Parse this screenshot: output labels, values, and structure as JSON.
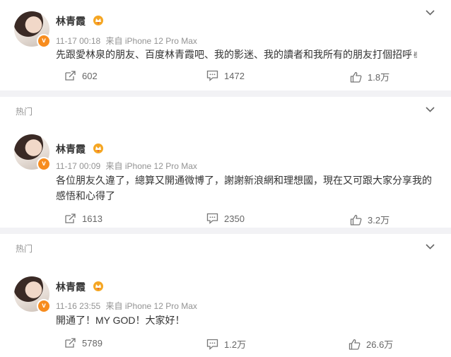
{
  "posts": [
    {
      "hot_label": "",
      "name": "林青霞",
      "time": "11-17 00:18",
      "source": "来自 iPhone 12 Pro Max",
      "text": "先跟愛林泉的朋友、百度林青霞吧、我的影迷、我的讀者和我所有的朋友打個招呼",
      "emoji": "✌",
      "repost": "602",
      "comment": "1472",
      "like": "1.8万"
    },
    {
      "hot_label": "热门",
      "name": "林青霞",
      "time": "11-17 00:09",
      "source": "来自 iPhone 12 Pro Max",
      "text": "各位朋友久違了，總算又開通微博了，謝謝新浪網和理想國，現在又可跟大家分享我的感悟和心得了",
      "emoji": "",
      "repost": "1613",
      "comment": "2350",
      "like": "3.2万"
    },
    {
      "hot_label": "热门",
      "name": "林青霞",
      "time": "11-16 23:55",
      "source": "来自 iPhone 12 Pro Max",
      "text": "開通了！MY GOD！大家好！",
      "emoji": "",
      "repost": "5789",
      "comment": "1.2万",
      "like": "26.6万"
    }
  ],
  "colors": {
    "meta": "#939393",
    "badge": "#f78c1e",
    "crown": "#f5a623"
  }
}
